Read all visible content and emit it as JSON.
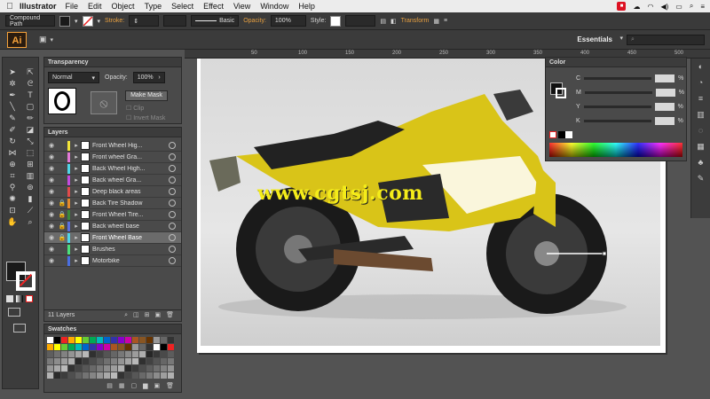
{
  "menubar": {
    "app": "Illustrator",
    "items": [
      "File",
      "Edit",
      "Object",
      "Type",
      "Select",
      "Effect",
      "View",
      "Window",
      "Help"
    ]
  },
  "control_bar": {
    "selection": "Compound Path",
    "stroke_label": "Stroke:",
    "brush": "Basic",
    "opacity_label": "Opacity:",
    "opacity_value": "100%",
    "style_label": "Style:",
    "transform_label": "Transform"
  },
  "app_bar": {
    "logo": "Ai",
    "workspace": "Essentials",
    "search_placeholder": ""
  },
  "transparency": {
    "tab": "Transparency",
    "blend_mode": "Normal",
    "opacity_label": "Opacity:",
    "opacity_value": "100%",
    "make_mask": "Make Mask",
    "clip": "Clip",
    "invert_mask": "Invert Mask"
  },
  "layers": {
    "tab": "Layers",
    "rows": [
      {
        "name": "Front Wheel Hig...",
        "color": "#f2e43a",
        "locked": false,
        "selected": false
      },
      {
        "name": "Front wheel Gra...",
        "color": "#e27ad6",
        "locked": false,
        "selected": false
      },
      {
        "name": "Back Wheel High...",
        "color": "#4fd6e8",
        "locked": false,
        "selected": false
      },
      {
        "name": "Back wheel Gra...",
        "color": "#c34be0",
        "locked": false,
        "selected": false
      },
      {
        "name": "Deep black areas",
        "color": "#e04b4b",
        "locked": false,
        "selected": false
      },
      {
        "name": "Back Tire Shadow",
        "color": "#e48a2c",
        "locked": true,
        "selected": false
      },
      {
        "name": "Front Wheel Tire...",
        "color": "#3a8a3a",
        "locked": true,
        "selected": false
      },
      {
        "name": "Back wheel base",
        "color": "#5a6fe0",
        "locked": true,
        "selected": false
      },
      {
        "name": "Front Wheel Base",
        "color": "#4fd6e8",
        "locked": true,
        "selected": true
      },
      {
        "name": "Brushes",
        "color": "#4be07a",
        "locked": false,
        "selected": false
      },
      {
        "name": "Motorbike",
        "color": "#4b6fe0",
        "locked": false,
        "selected": false
      }
    ],
    "count": "11 Layers"
  },
  "swatches": {
    "tab": "Swatches"
  },
  "color_panel": {
    "tab": "Color",
    "channels": [
      "C",
      "M",
      "Y",
      "K"
    ],
    "unit": "%"
  },
  "canvas": {
    "ruler_labels": [
      "50",
      "100",
      "150",
      "200",
      "250",
      "300",
      "350",
      "400",
      "450",
      "500"
    ],
    "watermark": "www.cgtsj.com"
  },
  "colors": {
    "accent": "#f6a23a",
    "bike_yellow": "#d9c418"
  }
}
